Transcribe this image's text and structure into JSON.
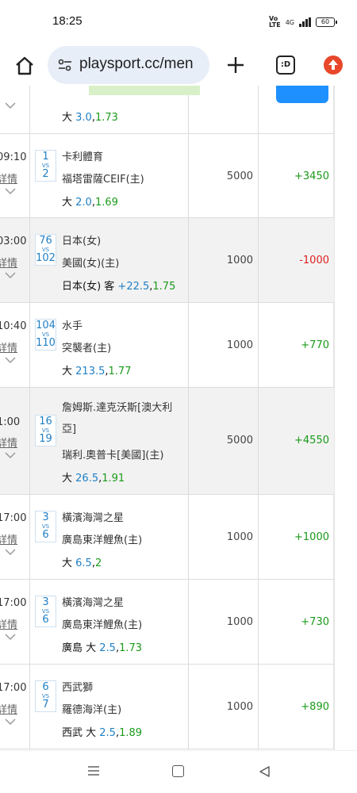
{
  "status": {
    "time": "18:25",
    "battery": "60",
    "network": "4G"
  },
  "browser": {
    "url": "playsport.cc/men",
    "tabs_label": ":D"
  },
  "rows": [
    {
      "time": "",
      "detail": "",
      "vs_top": "",
      "vs_bottom": "",
      "team_a": "",
      "team_b": "",
      "bet_pick": "大",
      "bet_line": "3.0",
      "bet_odds": "1.73",
      "amount": "",
      "result": "",
      "result_type": ""
    },
    {
      "time": "09:10",
      "detail": "詳情",
      "vs_top": "1",
      "vs_bottom": "2",
      "team_a": "卡利體育",
      "team_b": "福塔雷薩CEIF(主)",
      "bet_pick": "大",
      "bet_line": "2.0",
      "bet_odds": "1.69",
      "amount": "5000",
      "result": "+3450",
      "result_type": "win"
    },
    {
      "time": "03:00",
      "detail": "詳情",
      "vs_top": "76",
      "vs_bottom": "102",
      "team_a": "日本(女)",
      "team_b": "美國(女)(主)",
      "bet_pick": "日本(女) 客",
      "bet_line": "+22.5",
      "bet_odds": "1.75",
      "amount": "1000",
      "result": "-1000",
      "result_type": "lose"
    },
    {
      "time": "10:40",
      "detail": "詳情",
      "vs_top": "104",
      "vs_bottom": "110",
      "team_a": "水手",
      "team_b": "突襲者(主)",
      "bet_pick": "大",
      "bet_line": "213.5",
      "bet_odds": "1.77",
      "amount": "1000",
      "result": "+770",
      "result_type": "win"
    },
    {
      "time": "1:00",
      "detail": "詳情",
      "vs_top": "16",
      "vs_bottom": "19",
      "team_a": "詹姆斯.達克沃斯[澳大利亞]",
      "team_b": "瑞利.奧普卡[美國](主)",
      "bet_pick": "大",
      "bet_line": "26.5",
      "bet_odds": "1.91",
      "amount": "5000",
      "result": "+4550",
      "result_type": "win"
    },
    {
      "time": "17:00",
      "detail": "詳情",
      "vs_top": "3",
      "vs_bottom": "6",
      "team_a": "橫濱海灣之星",
      "team_b": "廣島東洋鯉魚(主)",
      "bet_pick": "大",
      "bet_line": "6.5",
      "bet_odds": "2",
      "amount": "1000",
      "result": "+1000",
      "result_type": "win"
    },
    {
      "time": "17:00",
      "detail": "詳情",
      "vs_top": "3",
      "vs_bottom": "6",
      "team_a": "橫濱海灣之星",
      "team_b": "廣島東洋鯉魚(主)",
      "bet_pick": "廣島 大",
      "bet_line": "2.5",
      "bet_odds": "1.73",
      "amount": "1000",
      "result": "+730",
      "result_type": "win"
    },
    {
      "time": "17:00",
      "detail": "詳情",
      "vs_top": "6",
      "vs_bottom": "7",
      "team_a": "西武獅",
      "team_b": "羅德海洋(主)",
      "bet_pick": "西武 大",
      "bet_line": "2.5",
      "bet_odds": "1.89",
      "amount": "1000",
      "result": "+890",
      "result_type": "win"
    }
  ],
  "colors": {
    "win": "#1a9a1a",
    "lose": "#e02020",
    "link_blue": "#1f7fc4",
    "shade": "#f2f2f2"
  }
}
